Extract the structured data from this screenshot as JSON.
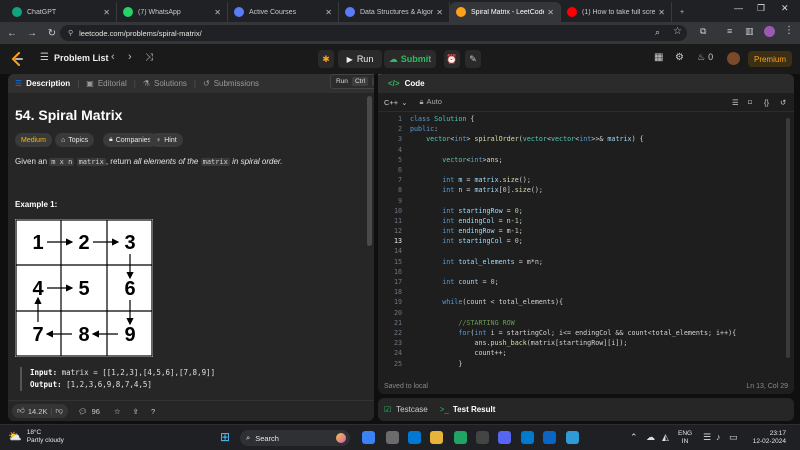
{
  "browser": {
    "tabs": [
      {
        "label": "ChatGPT",
        "icon": "chatgpt-icon",
        "color": "#10a37f"
      },
      {
        "label": "(7) WhatsApp",
        "icon": "whatsapp-icon",
        "color": "#25d366"
      },
      {
        "label": "Active Courses",
        "icon": "course-icon",
        "color": "#5b7cfa"
      },
      {
        "label": "Data Structures & Algorith",
        "icon": "course-icon",
        "color": "#5b7cfa"
      },
      {
        "label": "Spiral Matrix - LeetCode",
        "icon": "leetcode-icon",
        "color": "#ffa116"
      },
      {
        "label": "(1) How to take full screen",
        "icon": "youtube-icon",
        "color": "#ff0000"
      }
    ],
    "new_tab": "+",
    "url": "leetcode.com/problems/spiral-matrix/"
  },
  "header": {
    "problem_list": "Problem List",
    "run": "Run",
    "submit": "Submit",
    "streak": "0",
    "premium": "Premium",
    "tooltip_run": "Run",
    "tooltip_kbd": "Ctrl",
    "tooltip_kbd2": "'"
  },
  "left": {
    "tabs": [
      {
        "label": "Description",
        "icon": "description-icon"
      },
      {
        "label": "Editorial",
        "icon": "editorial-icon"
      },
      {
        "label": "Solutions",
        "icon": "flask-icon"
      },
      {
        "label": "Submissions",
        "icon": "history-icon"
      }
    ],
    "title": "54. Spiral Matrix",
    "difficulty": "Medium",
    "difficulty_color": "#ffb800",
    "topics": "Topics",
    "companies": "Companies",
    "hint": "Hint",
    "desc_pre": "Given an ",
    "desc_code1": "m x n",
    "desc_code2": "matrix",
    "desc_mid": ", return ",
    "desc_em": "all elements of the",
    "desc_code3": "matrix",
    "desc_post": " in spiral order.",
    "example_label": "Example 1:",
    "matrix": [
      [
        "1",
        "2",
        "3"
      ],
      [
        "4",
        "5",
        "6"
      ],
      [
        "7",
        "8",
        "9"
      ]
    ],
    "input_label": "Input:",
    "input_value": "matrix = [[1,2,3],[4,5,6],[7,8,9]]",
    "output_label": "Output:",
    "output_value": "[1,2,3,6,9,8,7,4,5]",
    "likes": "14.2K",
    "comments": "96"
  },
  "code": {
    "header": "Code",
    "language": "C++",
    "auto": "Auto",
    "saved": "Saved to local",
    "cursor": "Ln 13, Col 29",
    "current_line": 13,
    "lines": [
      [
        [
          "kw",
          "class "
        ],
        [
          "ty",
          "Solution "
        ],
        [
          "",
          "{"
        ]
      ],
      [
        [
          "kw",
          "public"
        ],
        [
          "",
          ":"
        ]
      ],
      [
        [
          "",
          "    "
        ],
        [
          "ty",
          "vector"
        ],
        [
          "",
          "<"
        ],
        [
          "kw",
          "int"
        ],
        [
          "",
          "> "
        ],
        [
          "fn",
          "spiralOrder"
        ],
        [
          "",
          "("
        ],
        [
          "ty",
          "vector"
        ],
        [
          "",
          "<"
        ],
        [
          "ty",
          "vector"
        ],
        [
          "",
          "<"
        ],
        [
          "kw",
          "int"
        ],
        [
          "",
          ">>& "
        ],
        [
          "id",
          "matrix"
        ],
        [
          "",
          ") {"
        ]
      ],
      [
        [
          "",
          ""
        ]
      ],
      [
        [
          "",
          "        "
        ],
        [
          "ty",
          "vector"
        ],
        [
          "",
          "<"
        ],
        [
          "kw",
          "int"
        ],
        [
          "",
          ">ans;"
        ]
      ],
      [
        [
          "",
          ""
        ]
      ],
      [
        [
          "",
          "        "
        ],
        [
          "kw",
          "int "
        ],
        [
          "id",
          "m"
        ],
        [
          "",
          " = "
        ],
        [
          "id",
          "matrix"
        ],
        [
          "",
          "."
        ],
        [
          "fn",
          "size"
        ],
        [
          "",
          "();"
        ]
      ],
      [
        [
          "",
          "        "
        ],
        [
          "kw",
          "int "
        ],
        [
          "id",
          "n"
        ],
        [
          "",
          " = "
        ],
        [
          "id",
          "matrix"
        ],
        [
          "",
          "["
        ],
        [
          "nm",
          "0"
        ],
        [
          "",
          "]."
        ],
        [
          "fn",
          "size"
        ],
        [
          "",
          "();"
        ]
      ],
      [
        [
          "",
          ""
        ]
      ],
      [
        [
          "",
          "        "
        ],
        [
          "kw",
          "int "
        ],
        [
          "id",
          "startingRow"
        ],
        [
          "",
          " = "
        ],
        [
          "nm",
          "0"
        ],
        [
          "",
          ";"
        ]
      ],
      [
        [
          "",
          "        "
        ],
        [
          "kw",
          "int "
        ],
        [
          "id",
          "endingCol"
        ],
        [
          "",
          " = n-"
        ],
        [
          "nm",
          "1"
        ],
        [
          "",
          ";"
        ]
      ],
      [
        [
          "",
          "        "
        ],
        [
          "kw",
          "int "
        ],
        [
          "id",
          "endingRow"
        ],
        [
          "",
          " = m-"
        ],
        [
          "nm",
          "1"
        ],
        [
          "",
          ";"
        ]
      ],
      [
        [
          "",
          "        "
        ],
        [
          "kw",
          "int "
        ],
        [
          "id",
          "startingCol"
        ],
        [
          "",
          " = "
        ],
        [
          "nm",
          "0"
        ],
        [
          "",
          ";"
        ]
      ],
      [
        [
          "",
          ""
        ]
      ],
      [
        [
          "",
          "        "
        ],
        [
          "kw",
          "int "
        ],
        [
          "id",
          "total_elements"
        ],
        [
          "",
          " = m*n;"
        ]
      ],
      [
        [
          "",
          ""
        ]
      ],
      [
        [
          "",
          "        "
        ],
        [
          "kw",
          "int "
        ],
        [
          "id",
          "count"
        ],
        [
          "",
          " = "
        ],
        [
          "nm",
          "0"
        ],
        [
          "",
          ";"
        ]
      ],
      [
        [
          "",
          ""
        ]
      ],
      [
        [
          "",
          "        "
        ],
        [
          "kw",
          "while"
        ],
        [
          "",
          "(count < total_elements){"
        ]
      ],
      [
        [
          "",
          ""
        ]
      ],
      [
        [
          "",
          "            "
        ],
        [
          "cm",
          "//STARTING ROW"
        ]
      ],
      [
        [
          "",
          "            "
        ],
        [
          "kw",
          "for"
        ],
        [
          "",
          "("
        ],
        [
          "kw",
          "int "
        ],
        [
          "",
          "i = startingCol; i<= endingCol && count<total_elements; i++){"
        ]
      ],
      [
        [
          "",
          "                "
        ],
        [
          "",
          "ans."
        ],
        [
          "fn",
          "push_back"
        ],
        [
          "",
          "(matrix[startingRow][i]);"
        ]
      ],
      [
        [
          "",
          "                "
        ],
        [
          "",
          "count++;"
        ]
      ],
      [
        [
          "",
          "            "
        ],
        [
          "",
          "}"
        ]
      ]
    ]
  },
  "test": {
    "testcase": "Testcase",
    "result": "Test Result"
  },
  "taskbar": {
    "temp": "18°C",
    "weather": "Partly cloudy",
    "search": "Search",
    "lang1": "ENG",
    "lang2": "IN",
    "time": "23:17",
    "date": "12-02-2024"
  }
}
